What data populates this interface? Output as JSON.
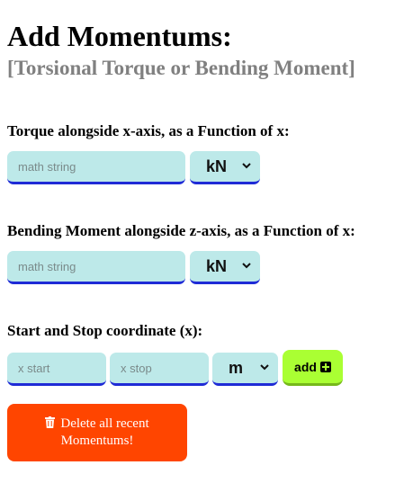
{
  "header": {
    "title": "Add Momentums:",
    "subtitle": "[Torsional Torque or Bending Moment]"
  },
  "torque": {
    "label": "Torque alongside x-axis, as a Function of x:",
    "input_placeholder": "math string",
    "unit_selected": "kN"
  },
  "bending": {
    "label": "Bending Moment alongside z-axis, as a Function of x:",
    "input_placeholder": "math string",
    "unit_selected": "kN"
  },
  "coords": {
    "label": "Start and Stop coordinate (x):",
    "start_placeholder": "x start",
    "stop_placeholder": "x stop",
    "unit_selected": "m",
    "add_label": "add"
  },
  "delete": {
    "line1": "Delete all recent",
    "line2": "Momentums!"
  },
  "colors": {
    "input_bg": "#bde9e9",
    "input_border": "#1f2bd6",
    "add_bg": "#aaff33",
    "delete_bg": "#ff4500"
  },
  "icons": [
    "chevron-down-icon",
    "plus-square-icon",
    "trash-icon"
  ]
}
